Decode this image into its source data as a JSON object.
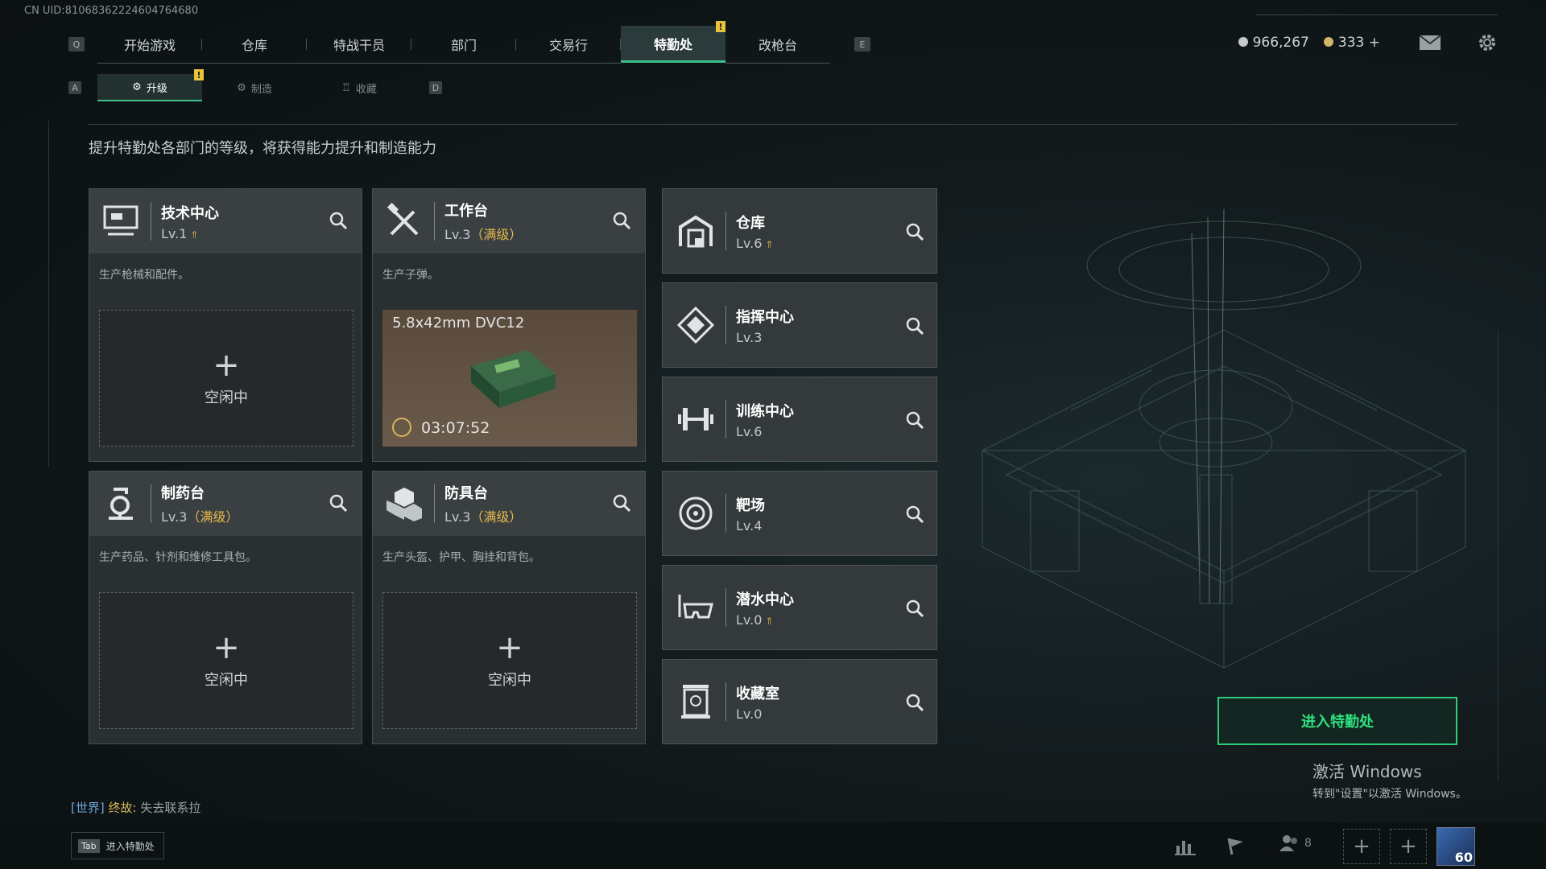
{
  "uid": "CN UID:81068362224604764680",
  "nav": {
    "left_key": "Q",
    "right_key": "E",
    "tabs": [
      {
        "label": "开始游戏"
      },
      {
        "label": "仓库"
      },
      {
        "label": "特战干员"
      },
      {
        "label": "部门"
      },
      {
        "label": "交易行"
      },
      {
        "label": "特勤处",
        "active": true,
        "alert": "!"
      },
      {
        "label": "改枪台"
      }
    ]
  },
  "currency": {
    "silver": "966,267",
    "gold": "333 +",
    "silver_color": "#c9c9c9",
    "gold_color": "#d3b56a"
  },
  "subnav": {
    "left_key": "A",
    "right_key": "D",
    "tabs": [
      {
        "label": "升级",
        "active": true,
        "alert": "!"
      },
      {
        "label": "制造"
      },
      {
        "label": "收藏"
      }
    ]
  },
  "description": "提升特勤处各部门的等级，将获得能力提升和制造能力",
  "cards": {
    "tech": {
      "title": "技术中心",
      "level": "Lv.1",
      "desc": "生产枪械和配件。",
      "plus": "+",
      "idle": "空闲中"
    },
    "workbench": {
      "title": "工作台",
      "level": "Lv.3",
      "max": "（满级）",
      "desc": "生产子弹。",
      "product": "5.8x42mm DVC12",
      "time": "03:07:52"
    },
    "pharmacy": {
      "title": "制药台",
      "level": "Lv.3",
      "max": "（满级）",
      "desc": "生产药品、针剂和维修工具包。",
      "plus": "+",
      "idle": "空闲中"
    },
    "armor": {
      "title": "防具台",
      "level": "Lv.3",
      "max": "（满级）",
      "desc": "生产头盔、护甲、胸挂和背包。",
      "plus": "+",
      "idle": "空闲中"
    }
  },
  "departments": [
    {
      "title": "仓库",
      "level": "Lv.6",
      "icon": "warehouse-icon"
    },
    {
      "title": "指挥中心",
      "level": "Lv.3",
      "icon": "command-icon"
    },
    {
      "title": "训练中心",
      "level": "Lv.6",
      "icon": "dumbbell-icon"
    },
    {
      "title": "靶场",
      "level": "Lv.4",
      "icon": "target-icon"
    },
    {
      "title": "潜水中心",
      "level": "Lv.0",
      "icon": "diving-mask-icon"
    },
    {
      "title": "收藏室",
      "level": "Lv.0",
      "icon": "collection-icon"
    }
  ],
  "enter_button": "进入特勤处",
  "windows_activation": {
    "line1": "激活 Windows",
    "line2": "转到\"设置\"以激活 Windows。"
  },
  "chat": {
    "channel": "[世界]",
    "name": "终故:",
    "message": "失去联系拉"
  },
  "bottom": {
    "tab_key": "Tab",
    "tab_label": "进入特勤处",
    "players": "8",
    "avatar_level": "60"
  }
}
